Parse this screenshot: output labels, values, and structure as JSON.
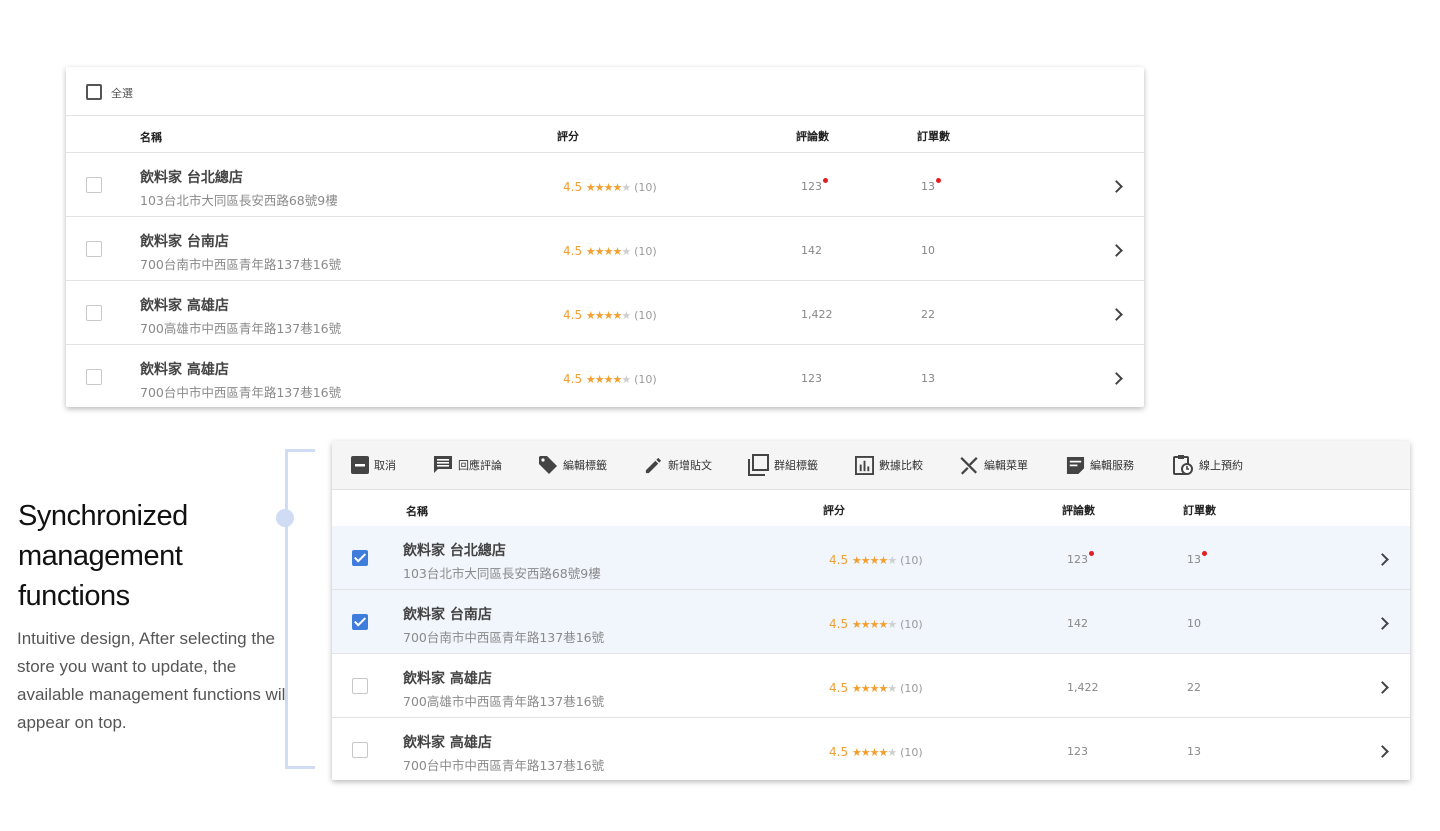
{
  "colors": {
    "accent": "#3f7ddc",
    "star": "#f0a030",
    "dot": "#e02020",
    "bracket": "#cfdcf4"
  },
  "top_table": {
    "select_all_label": "全選",
    "headers": {
      "name": "名稱",
      "rating": "評分",
      "reviews": "評論數",
      "orders": "訂單數"
    },
    "rows": [
      {
        "name": "飲料家 台北總店",
        "address": "103台北市大同區長安西路68號9樓",
        "score": "4.5",
        "count": "(10)",
        "reviews": "123",
        "orders": "13",
        "new_reviews": true,
        "new_orders": true,
        "checked": false
      },
      {
        "name": "飲料家 台南店",
        "address": "700台南市中西區青年路137巷16號",
        "score": "4.5",
        "count": "(10)",
        "reviews": "142",
        "orders": "10",
        "new_reviews": false,
        "new_orders": false,
        "checked": false
      },
      {
        "name": "飲料家 高雄店",
        "address": "700高雄市中西區青年路137巷16號",
        "score": "4.5",
        "count": "(10)",
        "reviews": "1,422",
        "orders": "22",
        "new_reviews": false,
        "new_orders": false,
        "checked": false
      },
      {
        "name": "飲料家 高雄店",
        "address": "700台中市中西區青年路137巷16號",
        "score": "4.5",
        "count": "(10)",
        "reviews": "123",
        "orders": "13",
        "new_reviews": false,
        "new_orders": false,
        "checked": false
      }
    ]
  },
  "bottom_table": {
    "toolbar": {
      "cancel": "取消",
      "reply_reviews": "回應評論",
      "edit_tags": "編輯標籤",
      "new_post": "新增貼文",
      "group_tags": "群組標籤",
      "compare_data": "數據比較",
      "edit_menu": "編輯菜單",
      "edit_services": "編輯服務",
      "online_booking": "線上預約"
    },
    "headers": {
      "name": "名稱",
      "rating": "評分",
      "reviews": "評論數",
      "orders": "訂單數"
    },
    "rows": [
      {
        "name": "飲料家 台北總店",
        "address": "103台北市大同區長安西路68號9樓",
        "score": "4.5",
        "count": "(10)",
        "reviews": "123",
        "orders": "13",
        "new_reviews": true,
        "new_orders": true,
        "checked": true
      },
      {
        "name": "飲料家 台南店",
        "address": "700台南市中西區青年路137巷16號",
        "score": "4.5",
        "count": "(10)",
        "reviews": "142",
        "orders": "10",
        "new_reviews": false,
        "new_orders": false,
        "checked": true
      },
      {
        "name": "飲料家 高雄店",
        "address": "700高雄市中西區青年路137巷16號",
        "score": "4.5",
        "count": "(10)",
        "reviews": "1,422",
        "orders": "22",
        "new_reviews": false,
        "new_orders": false,
        "checked": false
      },
      {
        "name": "飲料家 高雄店",
        "address": "700台中市中西區青年路137巷16號",
        "score": "4.5",
        "count": "(10)",
        "reviews": "123",
        "orders": "13",
        "new_reviews": false,
        "new_orders": false,
        "checked": false
      }
    ]
  },
  "caption": {
    "heading": "Synchronized management functions",
    "body": "Intuitive design, After selecting the store you want to update, the available management functions will appear on top."
  },
  "icons": {
    "cancel": "indeterminate-checkbox-icon",
    "reply_reviews": "comment-icon",
    "edit_tags": "tag-icon",
    "new_post": "pencil-icon",
    "group_tags": "copy-icon",
    "compare_data": "bar-chart-icon",
    "edit_menu": "utensils-icon",
    "edit_services": "note-icon",
    "online_booking": "clipboard-clock-icon",
    "row_action": "chevron-right-icon"
  }
}
